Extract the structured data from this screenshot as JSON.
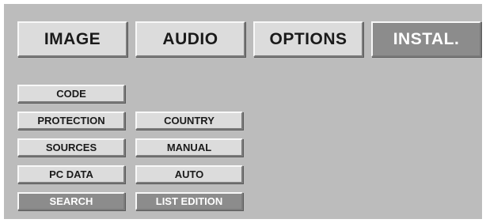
{
  "tabs": [
    {
      "label": "IMAGE",
      "active": false
    },
    {
      "label": "AUDIO",
      "active": false
    },
    {
      "label": "OPTIONS",
      "active": false
    },
    {
      "label": "INSTAL.",
      "active": true
    }
  ],
  "menu_left": [
    {
      "label": "CODE",
      "active": false
    },
    {
      "label": "PROTECTION",
      "active": false
    },
    {
      "label": "SOURCES",
      "active": false
    },
    {
      "label": "PC DATA",
      "active": false
    },
    {
      "label": "SEARCH",
      "active": true
    }
  ],
  "menu_right": [
    {
      "label": "COUNTRY",
      "active": false
    },
    {
      "label": "MANUAL",
      "active": false
    },
    {
      "label": "AUTO",
      "active": false
    },
    {
      "label": "LIST EDITION",
      "active": true
    }
  ],
  "colors": {
    "panel_bg": "#bcbcbc",
    "button_face": "#dcdcdc",
    "button_active": "#8c8c8c"
  }
}
